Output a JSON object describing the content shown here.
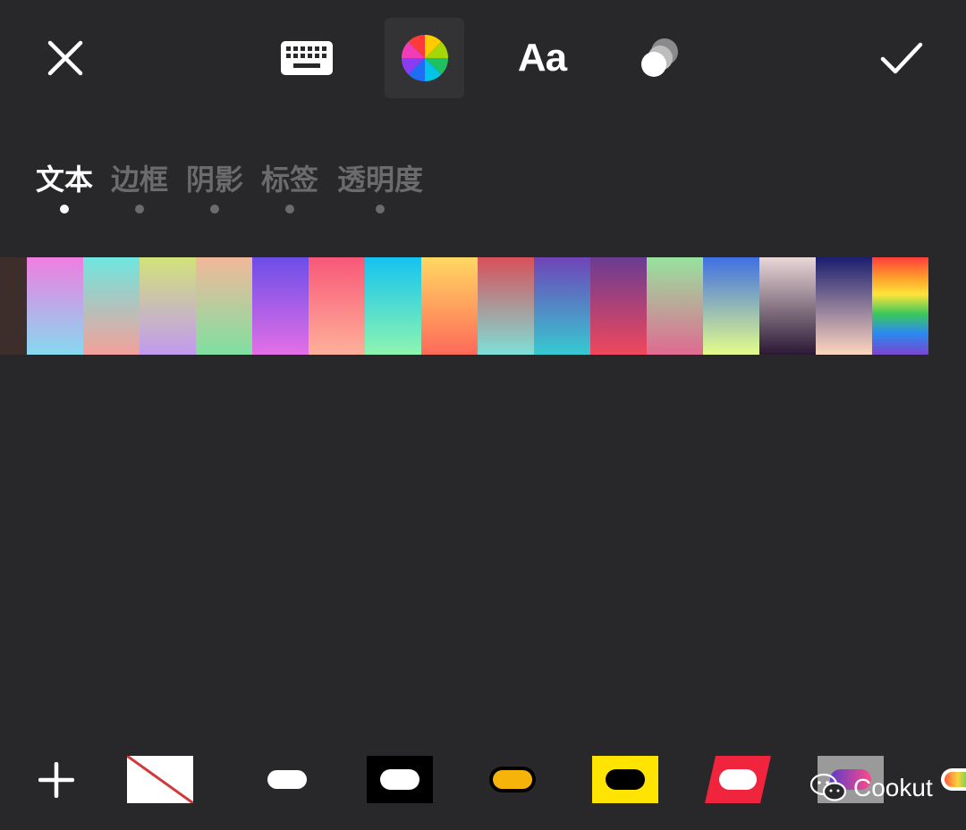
{
  "toolbar": {
    "close_icon": "close-icon",
    "keyboard_icon": "keyboard-icon",
    "color_wheel_icon": "color-wheel-icon",
    "font_label": "Aa",
    "overlap_icon": "overlap-circles-icon",
    "confirm_icon": "checkmark-icon"
  },
  "tabs": [
    {
      "label": "文本",
      "active": true
    },
    {
      "label": "边框",
      "active": false
    },
    {
      "label": "阴影",
      "active": false
    },
    {
      "label": "标签",
      "active": false
    },
    {
      "label": "透明度",
      "active": false
    }
  ],
  "colors": {
    "background": "#282729",
    "active_text": "#ffffff",
    "inactive_text": "#6b6a6c"
  },
  "gradients": [
    [
      "#f07de0",
      "#86d9f0"
    ],
    [
      "#6fe6e0",
      "#f4a09a"
    ],
    [
      "#d2e27a",
      "#c19af0"
    ],
    [
      "#f2b89b",
      "#7fe0a0"
    ],
    [
      "#6c4ee8",
      "#e36fe6"
    ],
    [
      "#f85878",
      "#ffb09a"
    ],
    [
      "#15c3f0",
      "#8ef5b0"
    ],
    [
      "#ffd862",
      "#ff6a5a"
    ],
    [
      "#d8505a",
      "#7ee0d8"
    ],
    [
      "#6f44b8",
      "#37cad2"
    ],
    [
      "#6a3c92",
      "#f0485c"
    ],
    [
      "#97e39e",
      "#e06a92"
    ],
    [
      "#3f6fe3",
      "#e4fd8a"
    ],
    [
      "#e9d7d8",
      "#2a1835"
    ],
    [
      "#1a1d70",
      "#ffd7c0"
    ],
    [
      "#ff3c3c",
      "#7a45d0"
    ]
  ],
  "bottom": {
    "add_icon": "plus-icon",
    "watermark": "Cookut",
    "watermark_icon": "wechat-icon"
  }
}
